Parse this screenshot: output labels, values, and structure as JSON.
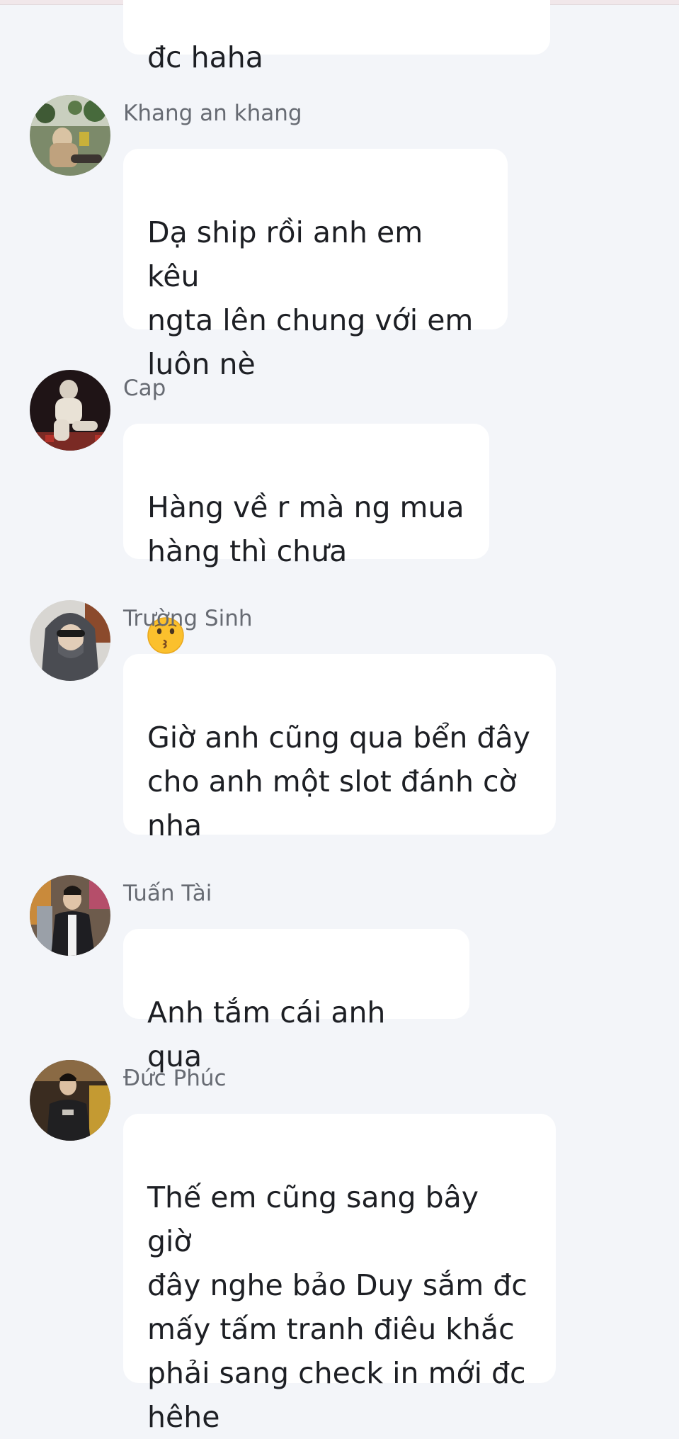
{
  "messages": [
    {
      "sender": "",
      "text": "đc haha"
    },
    {
      "sender": "Khang an khang",
      "text": "Dạ ship rồi anh em kêu\nngta lên chung với em\nluôn nè",
      "avatar": "avatar-photo-icon"
    },
    {
      "sender": "Cap",
      "text": "Hàng về r mà ng mua\nhàng thì chưa",
      "emoji": "😗",
      "avatar": "avatar-photo-icon"
    },
    {
      "sender": "Trường Sinh",
      "text": "Giờ anh cũng qua bển đây\ncho anh một slot đánh cờ\nnha",
      "avatar": "avatar-photo-icon"
    },
    {
      "sender": "Tuấn Tài",
      "text": "Anh tắm cái anh qua",
      "avatar": "avatar-photo-icon"
    },
    {
      "sender": "Đức Phúc",
      "text": "Thế em cũng sang bây giờ\nđây nghe bảo Duy sắm đc\nmấy tấm tranh điêu khắc\nphải sang check in mới đc\nhêhe",
      "avatar": "avatar-photo-icon"
    }
  ],
  "colors": {
    "background": "#f3f5f9",
    "bubble": "#ffffff",
    "sender_text": "#676b73",
    "message_text": "#1d1f24"
  }
}
